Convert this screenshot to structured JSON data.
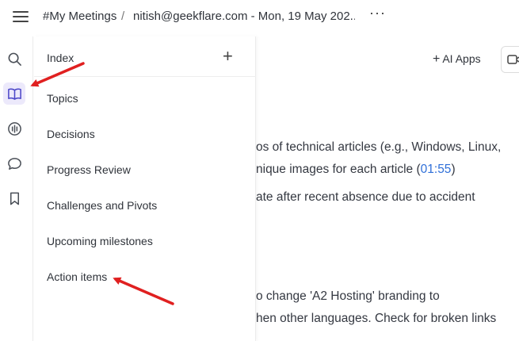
{
  "header": {
    "breadcrumb_root": "#My Meetings",
    "separator": "/",
    "breadcrumb_current": "nitish@geekflare.com - Mon, 19 May 202...",
    "more_label": "···"
  },
  "rail": {
    "items": [
      {
        "icon": "search-icon"
      },
      {
        "icon": "book-icon",
        "active": true
      },
      {
        "icon": "audio-waveform-icon"
      },
      {
        "icon": "chat-bubble-icon"
      },
      {
        "icon": "bookmark-icon"
      }
    ]
  },
  "index_panel": {
    "title": "Index",
    "add_label": "+",
    "items": [
      "Topics",
      "Decisions",
      "Progress Review",
      "Challenges and Pivots",
      "Upcoming milestones",
      "Action items"
    ]
  },
  "toolbar": {
    "ai_apps_plus": "+",
    "ai_apps_label": "AI Apps",
    "camera_icon": "video-camera-icon"
  },
  "content": {
    "line1": "os of technical articles (e.g., Windows, Linux,",
    "line2_prefix": "nique images for each article (",
    "line2_timestamp": "01:55",
    "line2_suffix": ")",
    "line3": "ate after recent absence due to accident",
    "line4": "o change 'A2 Hosting' branding to",
    "line5": "hen other languages. Check for broken links"
  },
  "annotations": {
    "arrow_color": "#e02020"
  }
}
